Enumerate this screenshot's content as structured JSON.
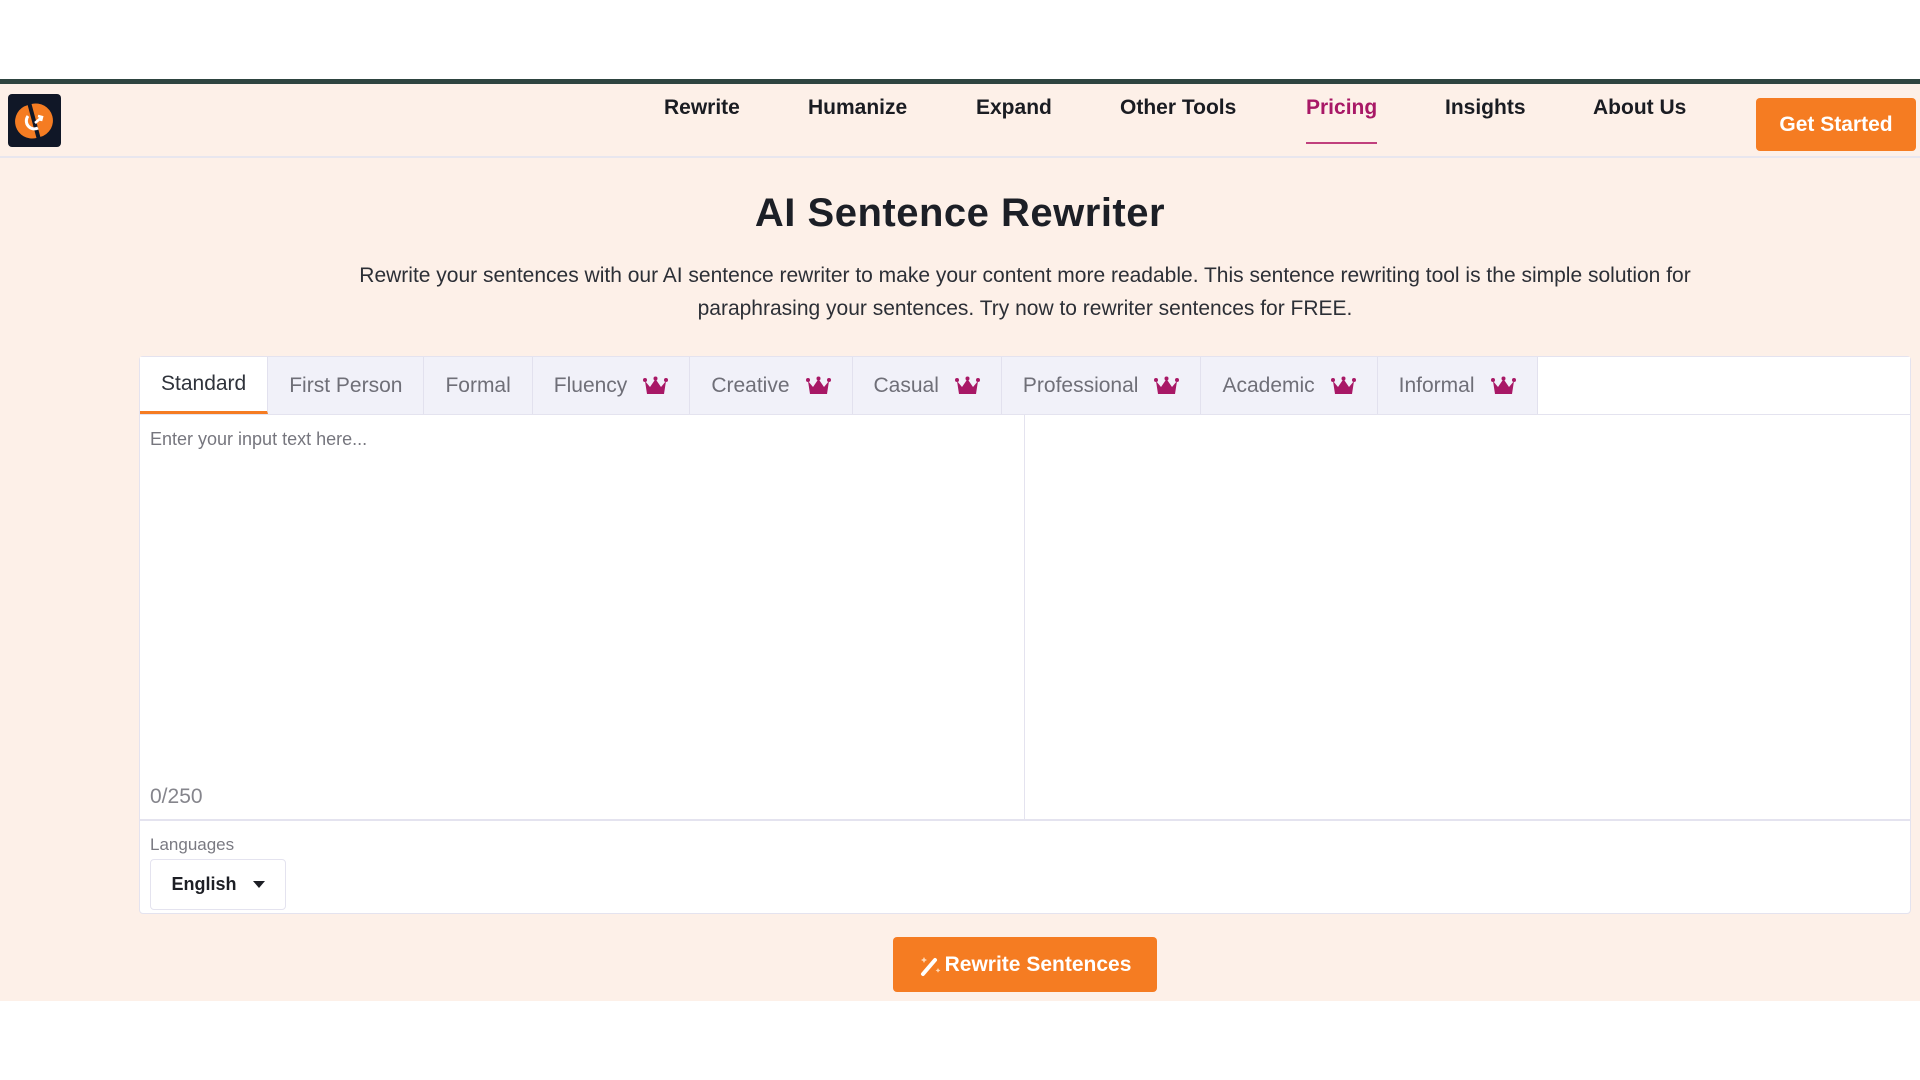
{
  "nav": {
    "items": [
      {
        "label": "Rewrite",
        "active": false
      },
      {
        "label": "Humanize",
        "active": false
      },
      {
        "label": "Expand",
        "active": false
      },
      {
        "label": "Other Tools",
        "active": false
      },
      {
        "label": "Pricing",
        "active": true
      },
      {
        "label": "Insights",
        "active": false
      },
      {
        "label": "About Us",
        "active": false
      }
    ],
    "cta_label": "Get Started"
  },
  "hero": {
    "title": "AI Sentence Rewriter",
    "description": "Rewrite your sentences with our AI sentence rewriter to make your content more readable. This sentence rewriting tool is the simple solution for paraphrasing your sentences. Try now to rewriter sentences for FREE."
  },
  "modes": {
    "tabs": [
      {
        "label": "Standard",
        "premium": false,
        "active": true
      },
      {
        "label": "First Person",
        "premium": false,
        "active": false
      },
      {
        "label": "Formal",
        "premium": false,
        "active": false
      },
      {
        "label": "Fluency",
        "premium": true,
        "active": false
      },
      {
        "label": "Creative",
        "premium": true,
        "active": false
      },
      {
        "label": "Casual",
        "premium": true,
        "active": false
      },
      {
        "label": "Professional",
        "premium": true,
        "active": false
      },
      {
        "label": "Academic",
        "premium": true,
        "active": false
      },
      {
        "label": "Informal",
        "premium": true,
        "active": false
      }
    ]
  },
  "editor": {
    "input_placeholder": "Enter your input text here...",
    "input_value": "",
    "counter": "0/250",
    "output_value": ""
  },
  "languages": {
    "label": "Languages",
    "selected": "English"
  },
  "action": {
    "rewrite_label": "Rewrite Sentences"
  },
  "colors": {
    "accent": "#f57c22",
    "premium_crown": "#a81866",
    "active_nav": "#a81866",
    "page_bg": "#fdf0e8"
  }
}
